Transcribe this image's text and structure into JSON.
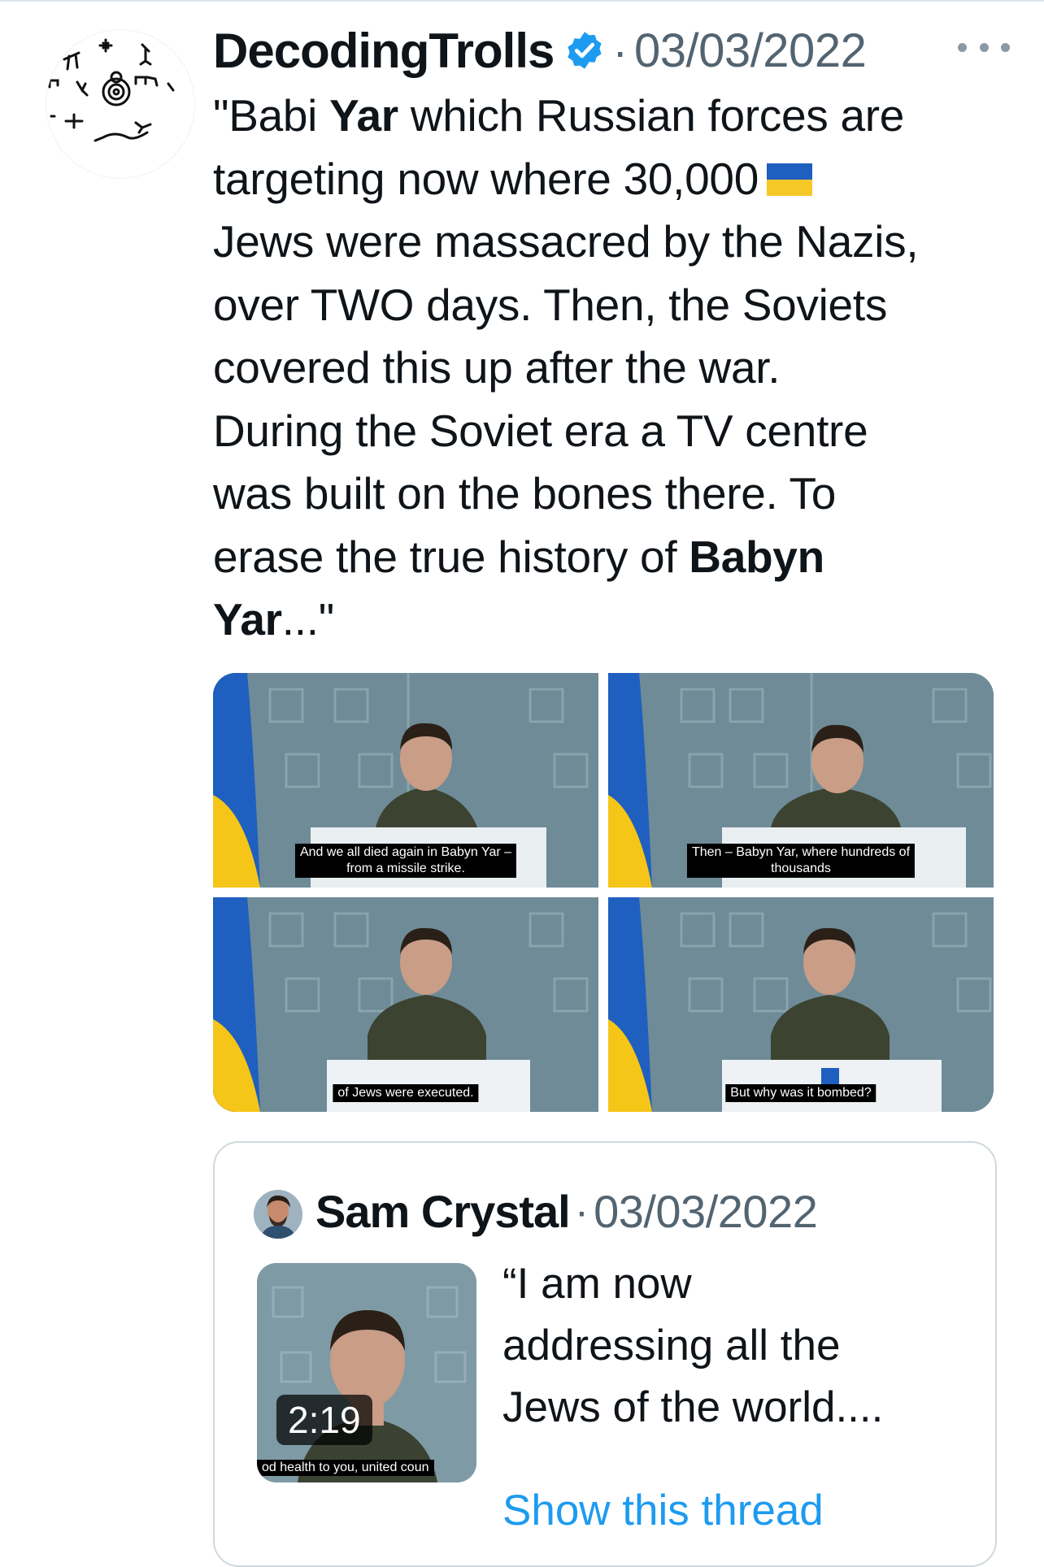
{
  "tweet": {
    "display_name": "DecodingTrolls",
    "date": "03/03/2022",
    "separator": "·",
    "text_lines": [
      [
        "\"Babi ",
        "Yar",
        " which Russian forces are"
      ],
      [
        "targeting now where 30,000 "
      ],
      [
        "Jews were massacred by the Nazis,"
      ],
      [
        "over TWO days. Then, the Soviets"
      ],
      [
        "covered this up after the war."
      ],
      [
        "During the Soviet era a TV centre"
      ],
      [
        "was built on the bones there. To"
      ],
      [
        "erase the true history of ",
        "Babyn"
      ],
      [
        "Yar",
        "...\""
      ]
    ],
    "line1_a": "\"Babi ",
    "line1_b": "Yar",
    "line1_c": " which Russian forces are",
    "line2": "targeting now where 30,000",
    "line3": "Jews were massacred by the Nazis,",
    "line4": "over TWO days. Then, the Soviets",
    "line5": "covered this up after the war.",
    "line6": "During the Soviet era a TV centre",
    "line7": "was built on the bones there. To",
    "line8_a": "erase the true history of ",
    "line8_b": "Babyn",
    "line9_a": "Yar",
    "line9_b": "...\"",
    "flag_colors": {
      "top": "#1f5fbf",
      "bottom": "#f7c928"
    }
  },
  "media": {
    "captions": [
      "And we all died again in Babyn Yar –\nfrom a missile strike.",
      "Then – Babyn Yar, where hundreds of\nthousands",
      "of Jews were executed.",
      "But why was it bombed?"
    ],
    "caption1_l1": "And we all died again in Babyn Yar –",
    "caption1_l2": "from a missile strike.",
    "caption2_l1": "Then – Babyn Yar, where hundreds of",
    "caption2_l2": "thousands",
    "caption3": "of Jews were executed.",
    "caption4": "But why was it bombed?"
  },
  "quote": {
    "display_name": "Sam Crystal",
    "separator": "·",
    "date": "03/03/2022",
    "video_duration": "2:19",
    "video_caption": "od health to you, united coun",
    "text_l1": "“I am now",
    "text_l2": "addressing all the",
    "text_l3": "Jews of the world....",
    "link": "Show this thread"
  },
  "icons": {
    "verified": "verified-badge-icon",
    "more": "more-options-icon",
    "flag": "ukraine-flag-emoji"
  },
  "colors": {
    "text": "#0f1419",
    "muted": "#536471",
    "verified": "#1d9bf0",
    "link": "#1d9bf0",
    "border": "#cfd9de"
  }
}
